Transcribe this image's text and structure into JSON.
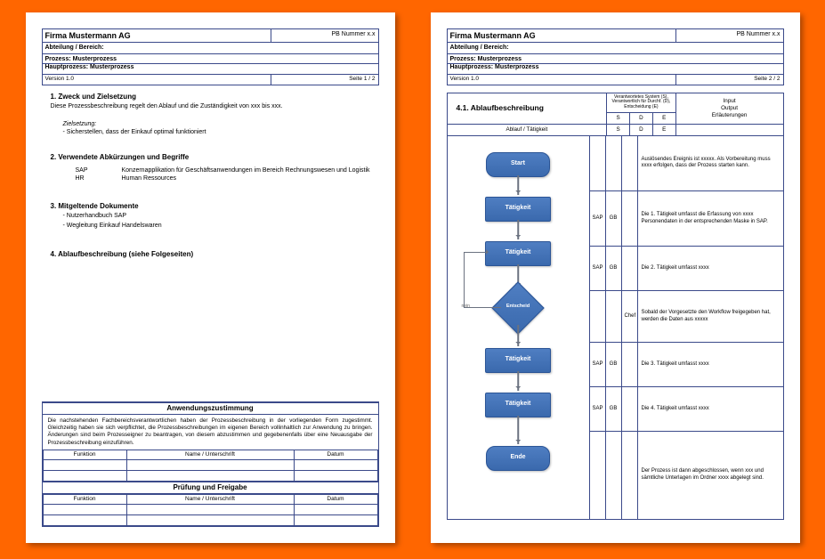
{
  "header": {
    "company": "Firma Mustermann AG",
    "pb_number": "PB Nummer x.x",
    "department_label": "Abteilung / Bereich:",
    "process_label": "Prozess: Musterprozess",
    "main_process_label": "Hauptprozess: Musterprozess",
    "version": "Version 1.0",
    "page_1": "Seite 1 / 2",
    "page_2": "Seite 2 / 2"
  },
  "page1": {
    "s1_title": "1.   Zweck und Zielsetzung",
    "s1_text": "Diese Prozessbeschreibung regelt den Ablauf und die Zuständigkeit von xxx bis xxx.",
    "s1_goal_label": "Zielsetzung:",
    "s1_goal_item": "- Sicherstellen, dass der Einkauf optimal funktioniert",
    "s2_title": "2.   Verwendete Abkürzungen und Begriffe",
    "defs": [
      {
        "k": "SAP",
        "v": "Konzernapplikation für Geschäftsanwendungen im Bereich Rechnungswesen und Logistik"
      },
      {
        "k": "HR",
        "v": "Human Ressources"
      }
    ],
    "s3_title": "3.   Mitgeltende Dokumente",
    "s3_items": [
      "- Nutzerhandbuch SAP",
      "- Wegleitung Einkauf Handelswaren"
    ],
    "s4_title": "4.   Ablaufbeschreibung (siehe Folgeseiten)",
    "approval_title": "Anwendungszustimmung",
    "approval_text": "Die nachstehenden Fachbereichsverantwortlichen haben der Prozessbeschreibung in der vorliegenden Form zugestimmt. Gleichzeitig haben sie sich verpflichtet, die Prozessbeschreibungen im eigenen Bereich vollinhaltlich zur Anwendung zu bringen. Änderungen sind beim Prozesseigner zu beantragen, von diesem abzustimmen und gegebenenfalls über eine Neuausgabe der Prozessbeschreibung einzuführen.",
    "col_function": "Funktion",
    "col_name": "Name / Unterschrift",
    "col_date": "Datum",
    "release_title": "Prüfung und Freigabe"
  },
  "page2": {
    "section_title": "4.1. Ablaufbeschreibung",
    "legend": "Verantwortetes System (S),\nVerantwortlich für Durchf. (D),\nEntscheidung (E)",
    "col_flow": "Ablauf / Tätigkeit",
    "col_s": "S",
    "col_d": "D",
    "col_e": "E",
    "col_io": "Input\nOutput\nErläuterungen",
    "nodes": {
      "start": "Start",
      "t1": "Tätigkeit",
      "t2": "Tätigkeit",
      "dec": "Entscheid",
      "t3": "Tätigkeit",
      "t4": "Tätigkeit",
      "end": "Ende"
    },
    "dec_no": "nein",
    "rows": [
      {
        "s": "",
        "d": "",
        "e": "",
        "note": "Auslösendes Ereignis ist xxxxx. Als Vorbereitung muss xxxx erfolgen, dass der Prozess starten kann."
      },
      {
        "s": "SAP",
        "d": "GB",
        "e": "",
        "note": "Die 1. Tätigkeit umfasst die Erfassung von xxxx Personendaten in der entsprechenden Maske in SAP."
      },
      {
        "s": "SAP",
        "d": "GB",
        "e": "",
        "note": "Die 2. Tätigkeit umfasst xxxx"
      },
      {
        "s": "",
        "d": "",
        "e": "Chef",
        "note": "Sobald der Vorgesetzte den Workflow freigegeben hat, werden die Daten aus xxxxx"
      },
      {
        "s": "SAP",
        "d": "GB",
        "e": "",
        "note": "Die 3. Tätigkeit umfasst xxxx"
      },
      {
        "s": "SAP",
        "d": "GB",
        "e": "",
        "note": "Die 4. Tätigkeit umfasst xxxx"
      },
      {
        "s": "",
        "d": "",
        "e": "",
        "note": "Der Prozess ist dann abgeschlossen, wenn xxx und sämtliche Unterlagen im Ordner xxxx abgelegt sind."
      }
    ]
  }
}
